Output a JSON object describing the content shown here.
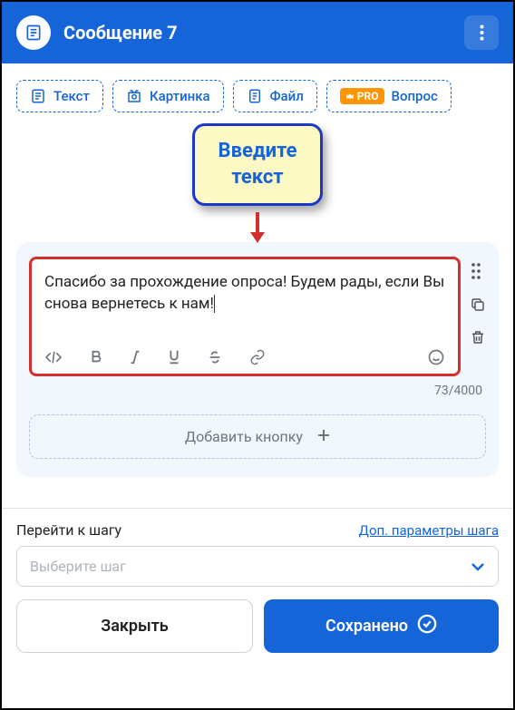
{
  "header": {
    "title": "Сообщение 7"
  },
  "content_types": {
    "text": "Текст",
    "image": "Картинка",
    "file": "Файл",
    "question": "Вопрос",
    "pro_label": "PRO"
  },
  "tooltip": {
    "line1": "Введите",
    "line2": "текст"
  },
  "editor": {
    "content": "Спасибо за прохождение опроса! Будем рады, если Вы снова вернетесь к нам!",
    "char_count": "73/4000"
  },
  "add_button": "Добавить кнопку",
  "step": {
    "label": "Перейти к шагу",
    "advanced_link": "Доп. параметры шага",
    "placeholder": "Выберите шаг"
  },
  "buttons": {
    "close": "Закрыть",
    "saved": "Сохранено"
  }
}
